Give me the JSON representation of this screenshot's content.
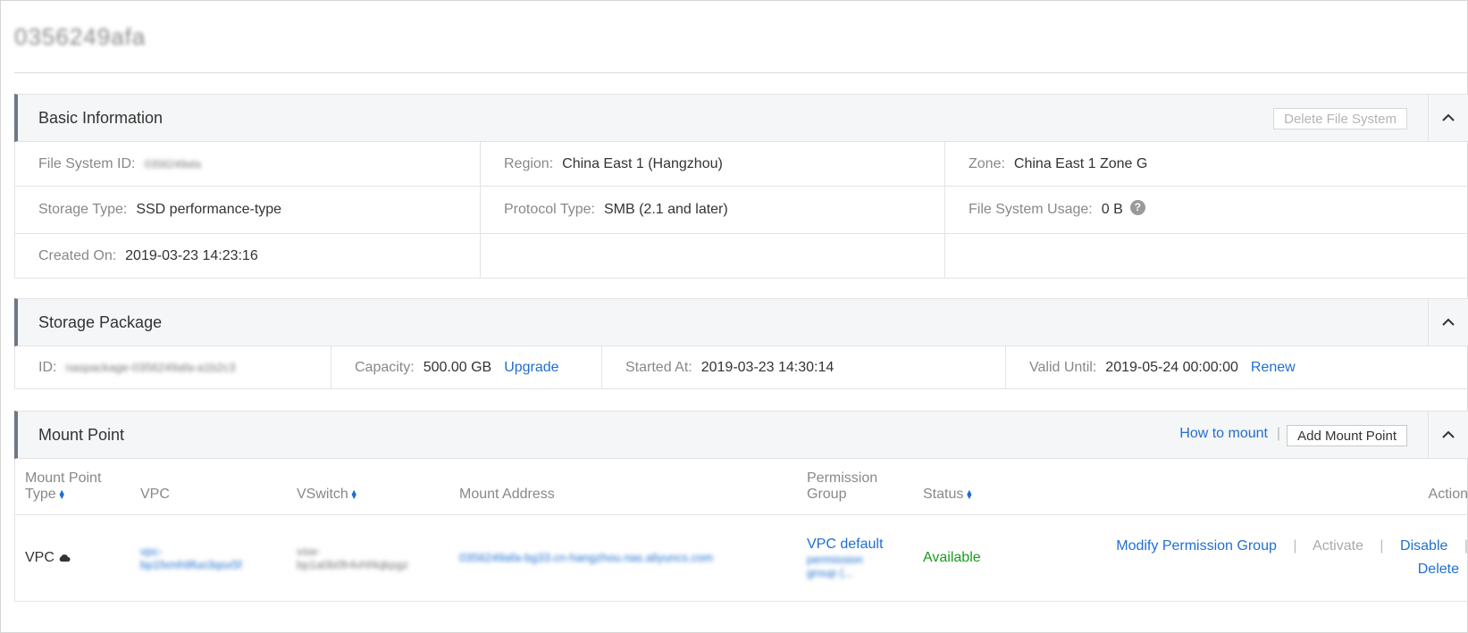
{
  "page": {
    "title": "0356249afa"
  },
  "basic_info": {
    "title": "Basic Information",
    "delete_button": "Delete File System",
    "fields": {
      "file_system_id": {
        "label": "File System ID:",
        "value": "0356249afa"
      },
      "region": {
        "label": "Region:",
        "value": "China East 1 (Hangzhou)"
      },
      "zone": {
        "label": "Zone:",
        "value": "China East 1 Zone G"
      },
      "storage_type": {
        "label": "Storage Type:",
        "value": "SSD performance-type"
      },
      "protocol_type": {
        "label": "Protocol Type:",
        "value": "SMB (2.1 and later)"
      },
      "usage": {
        "label": "File System Usage:",
        "value": "0 B"
      },
      "created_on": {
        "label": "Created On:",
        "value": "2019-03-23 14:23:16"
      }
    }
  },
  "storage_package": {
    "title": "Storage Package",
    "id": {
      "label": "ID:",
      "value": "naspackage-0356249afa-a1b2c3"
    },
    "capacity": {
      "label": "Capacity:",
      "value": "500.00 GB",
      "action": "Upgrade"
    },
    "started_at": {
      "label": "Started At:",
      "value": "2019-03-23 14:30:14"
    },
    "valid_until": {
      "label": "Valid Until:",
      "value": "2019-05-24 00:00:00",
      "action": "Renew"
    }
  },
  "mount_point": {
    "title": "Mount Point",
    "how_to_mount": "How to mount",
    "add_button": "Add Mount Point",
    "columns": {
      "type_1": "Mount Point",
      "type_2": "Type",
      "vpc": "VPC",
      "vswitch": "VSwitch",
      "address": "Mount Address",
      "perm_1": "Permission",
      "perm_2": "Group",
      "status": "Status",
      "action": "Action"
    },
    "rows": [
      {
        "type": "VPC",
        "vpc_1": "vpc-",
        "vpc_2": "bp1fxmh9fuo3qsx5f",
        "vswitch_1": "vsw-",
        "vswitch_2": "bp1a0b0fr4vhf4qkpgz",
        "address": "0356249afa-bg33.cn-hangzhou.nas.aliyuncs.com",
        "perm_1": "VPC default",
        "perm_2": "permission",
        "perm_3": "group (...",
        "status": "Available",
        "actions": {
          "modify": "Modify Permission Group",
          "activate": "Activate",
          "disable": "Disable",
          "delete": "Delete"
        }
      }
    ]
  }
}
